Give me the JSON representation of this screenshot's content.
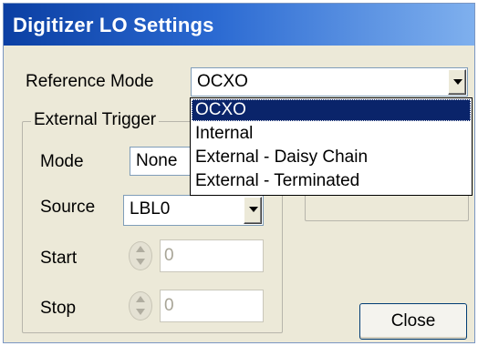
{
  "window": {
    "title": "Digitizer LO Settings"
  },
  "reference": {
    "label": "Reference Mode",
    "value": "OCXO",
    "options": [
      "OCXO",
      "Internal",
      "External - Daisy Chain",
      "External - Terminated"
    ]
  },
  "external_trigger": {
    "legend": "External Trigger",
    "mode_label": "Mode",
    "mode_value": "None",
    "source_label": "Source",
    "source_value": "LBL0",
    "start_label": "Start",
    "start_value": "0",
    "stop_label": "Stop",
    "stop_value": "0"
  },
  "buttons": {
    "close": "Close"
  }
}
